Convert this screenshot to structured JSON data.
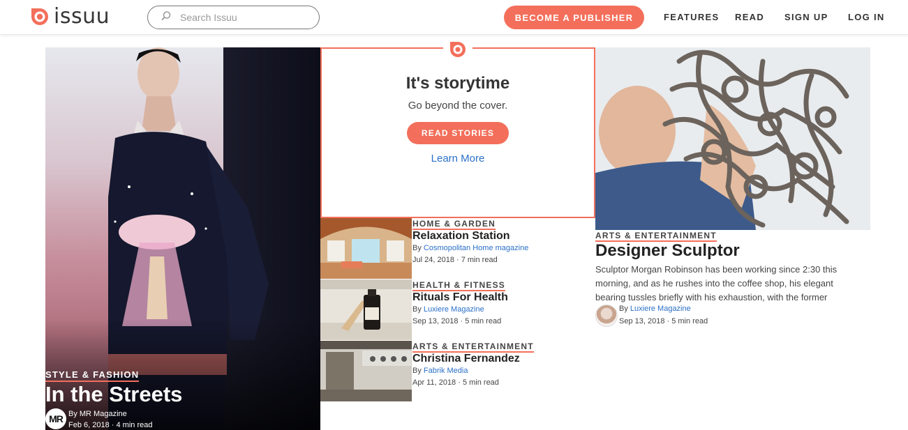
{
  "header": {
    "logo_text": "issuu",
    "search_placeholder": "Search Issuu",
    "cta_label": "BECOME A PUBLISHER",
    "nav": [
      "FEATURES",
      "READ",
      "SIGN UP",
      "LOG IN"
    ]
  },
  "brand": {
    "accent": "#f36f5b",
    "link": "#2a6fc7"
  },
  "feature_left": {
    "category": "STYLE & FASHION",
    "title": "In the Streets",
    "avatar_initials": "MR",
    "byline": "By MR Magazine",
    "date": "Feb 6, 2018 · 4 min read"
  },
  "storytime": {
    "title": "It's storytime",
    "subtitle": "Go beyond the cover.",
    "button_label": "READ STORIES",
    "link_label": "Learn More"
  },
  "stories": [
    {
      "category": "HOME & GARDEN",
      "title": "Relaxation Station",
      "by_prefix": "By",
      "publisher": "Cosmopolitan Home magazine",
      "date": "Jul 24, 2018 · 7 min read"
    },
    {
      "category": "HEALTH & FITNESS",
      "title": "Rituals For Health",
      "by_prefix": "By",
      "publisher": "Luxiere Magazine",
      "date": "Sep 13, 2018 · 5 min read"
    },
    {
      "category": "ARTS & ENTERTAINMENT",
      "title": "Christina Fernandez",
      "by_prefix": "By",
      "publisher": "Fabrik Media",
      "date": "Apr 11, 2018 · 5 min read"
    }
  ],
  "feature_right": {
    "category": "ARTS & ENTERTAINMENT",
    "title": "Designer Sculptor",
    "excerpt": "Sculptor Morgan Robinson has been working since 2:30 this morning, and as he rushes into the coffee shop, his elegant bearing tussles briefly with his exhaustion, with the former",
    "by_prefix": "By",
    "publisher": "Luxiere Magazine",
    "date": "Sep 13, 2018 · 5 min read"
  },
  "icons": [
    "issuu-logo-icon",
    "search-icon"
  ]
}
